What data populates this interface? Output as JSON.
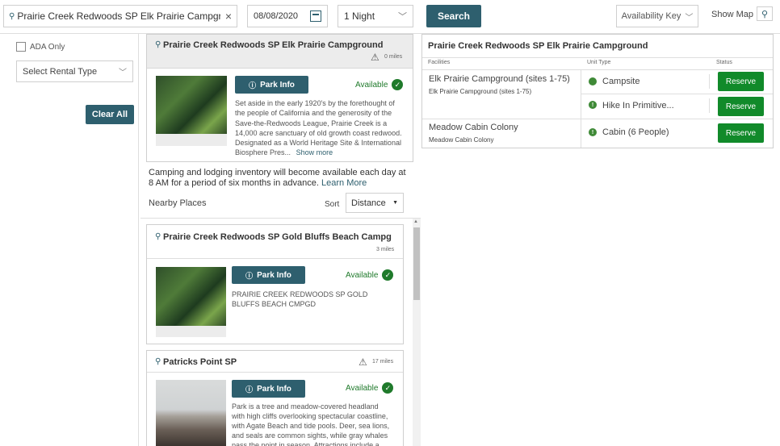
{
  "topbar": {
    "search_value": "Prairie Creek Redwoods SP Elk Prairie Campground",
    "date_value": "08/08/2020",
    "nights_value": "1 Night",
    "search_button": "Search",
    "availability_key": "Availability Key",
    "show_map": "Show Map"
  },
  "filters": {
    "ada_only": "ADA Only",
    "rental_type": "Select Rental Type",
    "clear_all": "Clear All"
  },
  "selected": {
    "title": "Prairie Creek Redwoods SP Elk Prairie Campground",
    "distance": "0 miles",
    "park_info": "Park Info",
    "status": "Available",
    "description": "Set aside in the early 1920's by the forethought of the people of California and the generosity of the Save-the-Redwoods League, Prairie Creek is a 14,000 acre sanctuary of old growth coast redwood. Designated as a World Heritage Site & International Biosphere Pres...",
    "show_more": "Show more"
  },
  "notice": {
    "text": "Camping and lodging inventory will become available each day at 8 AM for a period of six months in advance.",
    "link": "Learn More"
  },
  "nearby": {
    "heading": "Nearby Places",
    "sort_label": "Sort",
    "sort_value": "Distance",
    "places": [
      {
        "title": "Prairie Creek Redwoods SP Gold Bluffs Beach Campg",
        "distance": "3 miles",
        "park_info": "Park Info",
        "status": "Available",
        "description": "PRAIRIE CREEK REDWOODS SP GOLD BLUFFS BEACH CMPGD"
      },
      {
        "title": "Patricks Point SP",
        "distance": "17 miles",
        "park_info": "Park Info",
        "status": "Available",
        "description": "Park is a tree and meadow-covered headland with high cliffs overlooking spectacular coastline, with Agate Beach and tide pools. Deer, sea lions, and seals are common sights, while gray whales pass the point in season. Attractions include a"
      }
    ]
  },
  "facilities_panel": {
    "title": "Prairie Creek Redwoods SP Elk Prairie Campground",
    "col_facilities": "Facilities",
    "col_unit_type": "Unit Type",
    "col_status": "Status",
    "rows": [
      {
        "facility": "Elk Prairie Campground (sites 1-75)",
        "facility_sub": "Elk Prairie Campground (sites 1-75)",
        "unit": "Campsite",
        "action": "Reserve"
      },
      {
        "unit": "Hike In Primitive...",
        "action": "Reserve"
      },
      {
        "facility": "Meadow Cabin Colony",
        "facility_sub": "Meadow Cabin Colony",
        "unit": "Cabin (6 People)",
        "action": "Reserve"
      }
    ]
  },
  "colors": {
    "primary": "#2e5f6e",
    "available_green": "#1f7a2b",
    "reserve_green": "#118a2a"
  }
}
